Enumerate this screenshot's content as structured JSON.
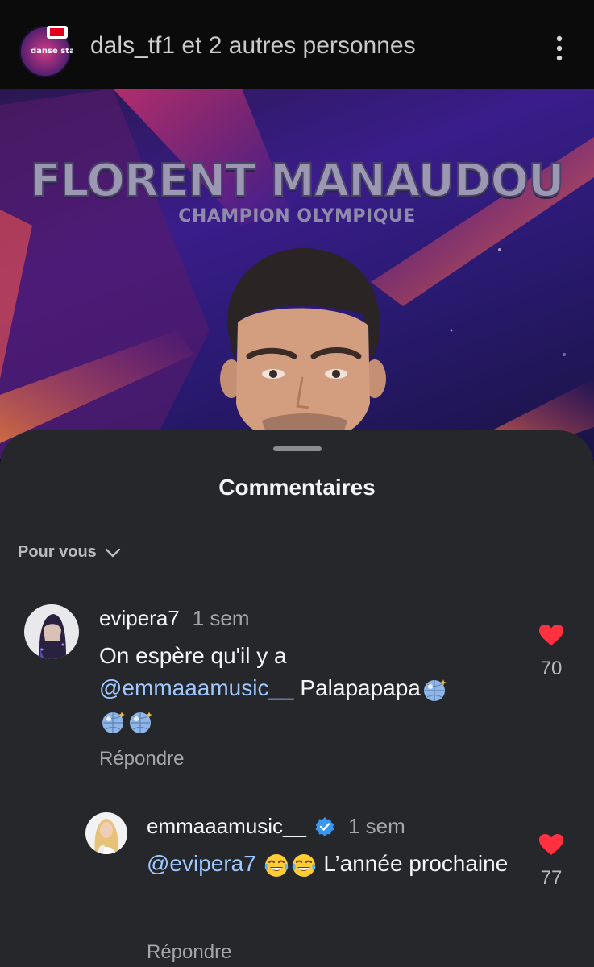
{
  "header": {
    "username": "dals_tf1",
    "suffix": "et 2 autres personnes",
    "avatar_icon": "dals-tf1-logo-avatar",
    "avatar_text": "danse stars"
  },
  "hero": {
    "name": "FLORENT MANAUDOU",
    "subtitle": "CHAMPION OLYMPIQUE"
  },
  "sheet": {
    "title": "Commentaires",
    "filter": "Pour vous"
  },
  "comments": [
    {
      "username": "evipera7",
      "time": "1 sem",
      "text_before": "On espère qu'il y a",
      "mention": "@emmaaamusic__",
      "text_after": "Palapapapa",
      "emoji": "mirror-ball",
      "reply": "Répondre",
      "likes": "70"
    },
    {
      "username": "emmaaamusic__",
      "time": "1 sem",
      "verified": true,
      "mention": "@evipera7",
      "emoji": "tears-of-joy",
      "text_after": "L’année prochaine",
      "reply": "Répondre",
      "likes": "77"
    }
  ],
  "colors": {
    "sheet_bg": "#25272b",
    "mention": "#9ec8ff",
    "heart": "#ff3040",
    "verified": "#3897f0"
  }
}
